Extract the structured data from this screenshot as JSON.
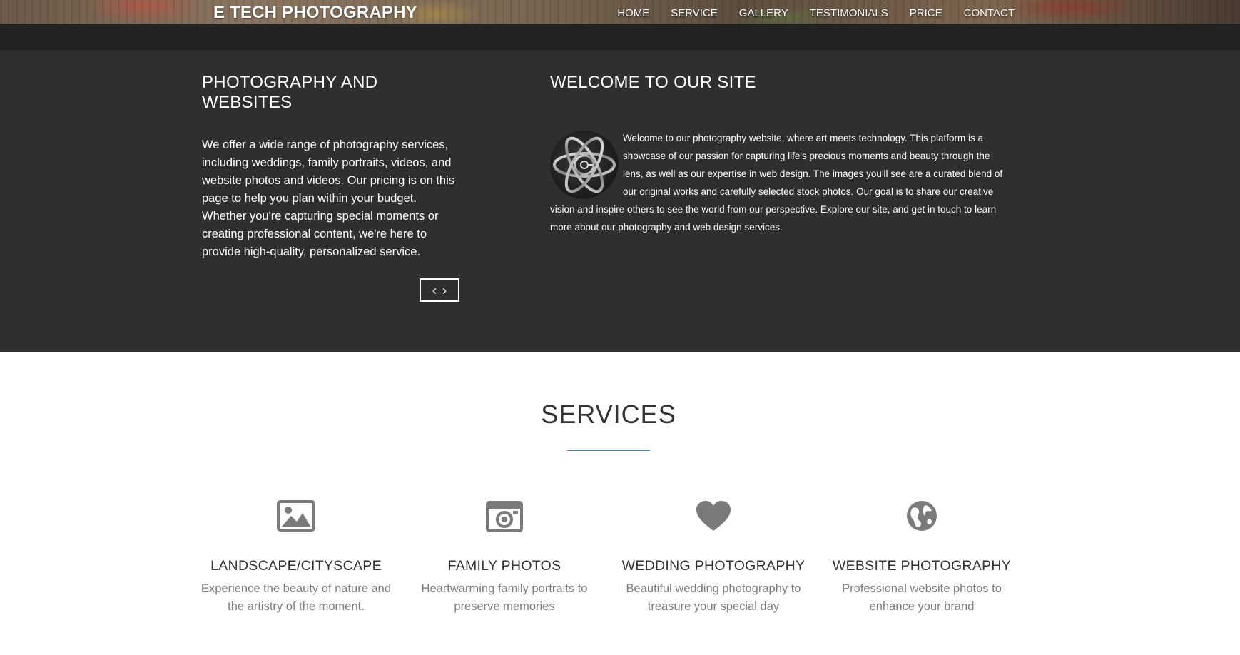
{
  "header": {
    "brand": "E TECH PHOTOGRAPHY",
    "nav": [
      "HOME",
      "SERVICE",
      "GALLERY",
      "TESTIMONIALS",
      "PRICE",
      "CONTACT"
    ]
  },
  "hero": {
    "left": {
      "title": "PHOTOGRAPHY AND WEBSITES",
      "body": "We offer a wide range of photography services, including weddings, family portraits, videos, and website photos and videos. Our pricing is on this page to help you plan within your budget. Whether you're capturing special moments or creating professional content, we're here to provide high-quality, personalized service."
    },
    "slider": {
      "prev_icon": "chevron-left-icon",
      "next_icon": "chevron-right-icon",
      "prev_glyph": "‹",
      "next_glyph": "›"
    },
    "right": {
      "title": "WELCOME TO OUR SITE",
      "logo_icon": "atom-logo-icon",
      "body": "Welcome to our photography website, where art meets technology. This platform is a showcase of our passion for capturing life's precious moments and beauty through the lens, as well as our expertise in web design. The images you'll see are a curated blend of our original works and carefully selected stock photos. Our goal is to share our creative vision and inspire others to see the world from our perspective. Explore our site, and get in touch to learn more about our photography and web design services."
    }
  },
  "services": {
    "title": "SERVICES",
    "accent": "#1c8bd6",
    "items": [
      {
        "icon": "picture-icon",
        "title": "LANDSCAPE/CITYSCAPE",
        "desc": "Experience the beauty of nature and the artistry of the moment."
      },
      {
        "icon": "camera-icon",
        "title": "FAMILY PHOTOS",
        "desc": "Heartwarming family portraits to preserve memories"
      },
      {
        "icon": "heart-icon",
        "title": "WEDDING PHOTOGRAPHY",
        "desc": "Beautiful wedding photography to treasure your special day"
      },
      {
        "icon": "globe-icon",
        "title": "WEBSITE PHOTOGRAPHY",
        "desc": "Professional website photos to enhance your brand"
      }
    ]
  }
}
